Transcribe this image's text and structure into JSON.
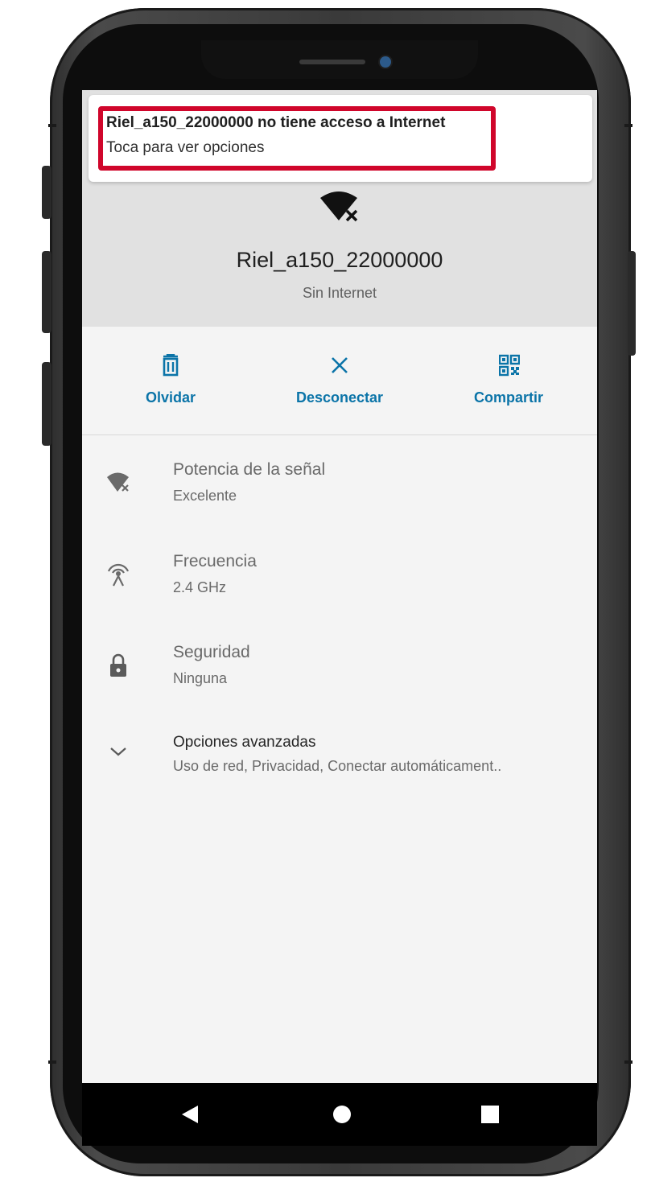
{
  "notification": {
    "title": "Riel_a150_22000000 no tiene acceso a Internet",
    "subtitle": "Toca para ver opciones",
    "highlight_color": "#d0062b"
  },
  "network": {
    "icon": "wifi-no-internet-icon",
    "name": "Riel_a150_22000000",
    "status": "Sin Internet"
  },
  "actions": [
    {
      "icon": "trash-icon",
      "label": "Olvidar"
    },
    {
      "icon": "close-icon",
      "label": "Desconectar"
    },
    {
      "icon": "qr-code-icon",
      "label": "Compartir"
    }
  ],
  "accent_color": "#0b74a8",
  "details": [
    {
      "icon": "wifi-no-internet-icon",
      "title": "Potencia de la señal",
      "value": "Excelente"
    },
    {
      "icon": "antenna-icon",
      "title": "Frecuencia",
      "value": "2.4 GHz"
    },
    {
      "icon": "lock-icon",
      "title": "Seguridad",
      "value": "Ninguna"
    },
    {
      "icon": "chevron-down-icon",
      "title": "Opciones avanzadas",
      "value": "Uso de red, Privacidad, Conectar automáticament.."
    }
  ],
  "navbar": [
    {
      "icon": "back-triangle-icon"
    },
    {
      "icon": "home-circle-icon"
    },
    {
      "icon": "recents-square-icon"
    }
  ]
}
